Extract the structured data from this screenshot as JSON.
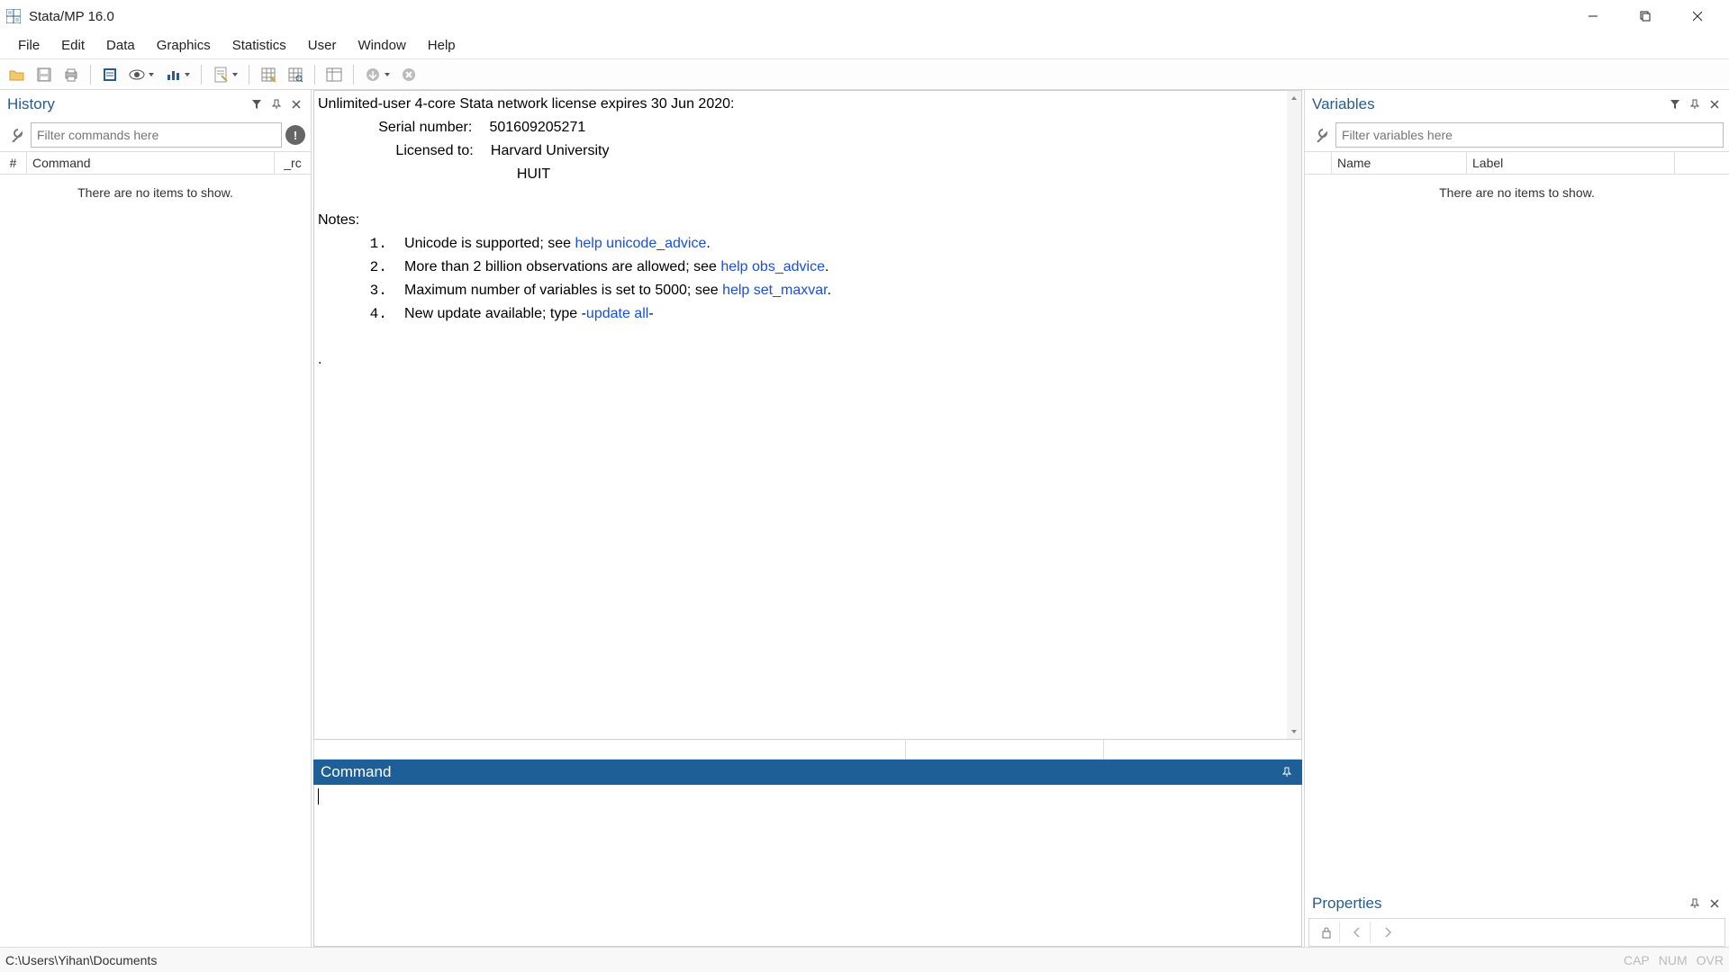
{
  "titlebar": {
    "title": "Stata/MP 16.0"
  },
  "menubar": {
    "items": [
      "File",
      "Edit",
      "Data",
      "Graphics",
      "Statistics",
      "User",
      "Window",
      "Help"
    ]
  },
  "history": {
    "title": "History",
    "filter_placeholder": "Filter commands here",
    "columns": {
      "num": "#",
      "cmd": "Command",
      "rc": "_rc"
    },
    "empty": "There are no items to show."
  },
  "results": {
    "license_line": "Unlimited-user 4-core Stata network license expires 30 Jun 2020:",
    "serial_label": "Serial number:",
    "serial_value": "501609205271",
    "licensed_label": "Licensed to:",
    "licensed_value1": "Harvard University",
    "licensed_value2": "HUIT",
    "notes_label": "Notes:",
    "note1_pre": "Unicode is supported; see ",
    "note1_link": "help unicode_advice",
    "note1_post": ".",
    "note2_pre": "More than 2 billion observations are allowed; see ",
    "note2_link": "help obs_advice",
    "note2_post": ".",
    "note3_pre": "Maximum number of variables is set to 5000; see ",
    "note3_link": "help set_maxvar",
    "note3_post": ".",
    "note4_pre": "New update available; type -",
    "note4_link": "update all",
    "note4_post": "-",
    "prompt": "."
  },
  "command": {
    "title": "Command"
  },
  "variables": {
    "title": "Variables",
    "filter_placeholder": "Filter variables here",
    "columns": {
      "name": "Name",
      "label": "Label"
    },
    "empty": "There are no items to show."
  },
  "properties": {
    "title": "Properties"
  },
  "footer": {
    "path": "C:\\Users\\Yihan\\Documents",
    "cap": "CAP",
    "num": "NUM",
    "ovr": "OVR"
  }
}
